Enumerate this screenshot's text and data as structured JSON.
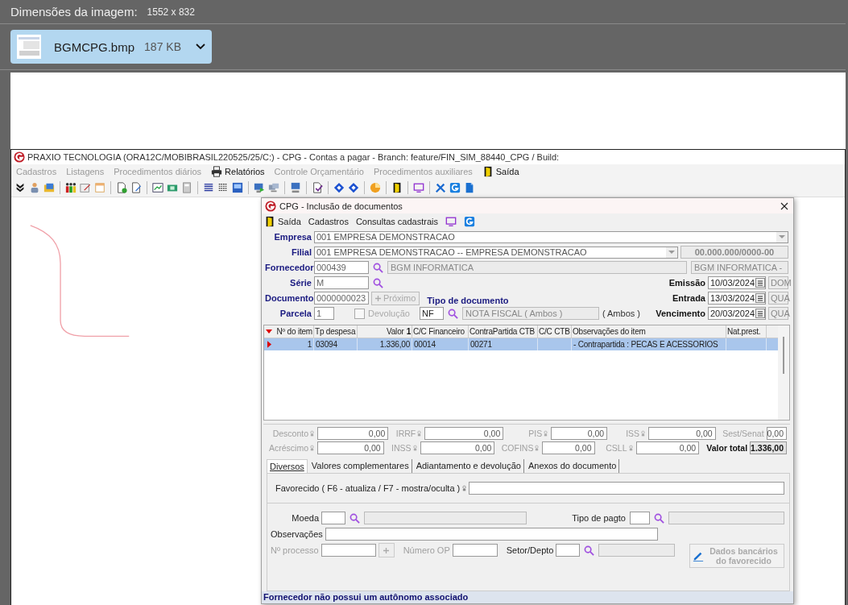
{
  "viewer": {
    "label": "Dimensões da imagem:",
    "dimensions": "1552 x 832",
    "file_name": "BGMCPG.bmp",
    "file_size": "187 KB"
  },
  "app": {
    "title": "PRAXIO TECNOLOGIA (ORA12C/MOBIBRASIL220525/25/C:) - CPG - Contas a pagar - Branch: feature/FIN_SIM_88440_CPG / Build:",
    "menu": [
      {
        "label": "Cadastros",
        "disabled": true
      },
      {
        "label": "Listagens",
        "disabled": true
      },
      {
        "label": "Procedimentos diários",
        "disabled": true
      },
      {
        "label": "Relatórios",
        "disabled": false
      },
      {
        "label": "Controle Orçamentário",
        "disabled": true
      },
      {
        "label": "Procedimentos auxiliares",
        "disabled": true
      },
      {
        "label": "Saída",
        "disabled": false
      }
    ]
  },
  "dialog": {
    "title": "CPG - Inclusão de documentos",
    "menu": [
      {
        "label": "Saída"
      },
      {
        "label": "Cadastros"
      },
      {
        "label": "Consultas cadastrais"
      }
    ],
    "form": {
      "empresa": {
        "label": "Empresa",
        "value": "001 EMPRESA DEMONSTRACAO"
      },
      "filial": {
        "label": "Filial",
        "value": "001 EMPRESA DEMONSTRACAO -- EMPRESA DEMONSTRACAO",
        "cnpj": "00.000.000/0000-00"
      },
      "fornecedor": {
        "label": "Fornecedor",
        "code": "000439",
        "name": "BGM INFORMATICA",
        "alt_name": "BGM INFORMATICA -"
      },
      "serie": {
        "label": "Série",
        "value": "M"
      },
      "documento": {
        "label": "Documento",
        "value": "0000000023"
      },
      "proximo": {
        "label": "Próximo",
        "disabled": true
      },
      "parcela": {
        "label": "Parcela",
        "value": "1"
      },
      "devolucao": {
        "label": "Devolução",
        "checked": false,
        "disabled": true
      },
      "tipo_documento": {
        "label": "Tipo de documento",
        "code": "NF",
        "name": "NOTA FISCAL ( Ambos )",
        "note": "( Ambos )"
      },
      "dates": [
        {
          "label": "Emissão",
          "value": "10/03/2024",
          "weekday": "DOM"
        },
        {
          "label": "Entrada",
          "value": "13/03/2024",
          "weekday": "QUA"
        },
        {
          "label": "Vencimento",
          "value": "20/03/2024",
          "weekday": "QUA"
        }
      ]
    },
    "table": {
      "columns": [
        {
          "label": "Nº do item"
        },
        {
          "label": "Tp despesa"
        },
        {
          "label": "Valor",
          "sort": "1"
        },
        {
          "label": "C/C Financeiro"
        },
        {
          "label": "ContraPartida CTB"
        },
        {
          "label": "C/C CTB"
        },
        {
          "label": "Observações do item"
        },
        {
          "label": "Nat.prest."
        }
      ],
      "rows": [
        {
          "selected": true,
          "cells": [
            "1",
            "03094",
            "1.336,00",
            "00014",
            "00271",
            null,
            "- Contrapartida : PECAS E ACESSORIOS",
            null
          ]
        }
      ]
    },
    "totals": [
      {
        "kind": "field",
        "label": "Desconto",
        "value": "0,00",
        "disabled": true,
        "icon": true
      },
      {
        "kind": "field",
        "label": "IRRF",
        "value": "0,00",
        "disabled": true,
        "icon": true
      },
      {
        "kind": "field",
        "label": "PIS",
        "value": "0,00",
        "disabled": true,
        "icon": true
      },
      {
        "kind": "field",
        "label": "ISS",
        "value": "0,00",
        "disabled": true,
        "icon": true
      },
      {
        "kind": "field",
        "label": "Sest/Senat",
        "value": "0,00",
        "disabled": true,
        "icon": false
      },
      {
        "kind": "field",
        "label": "Acréscimo",
        "value": "0,00",
        "disabled": true,
        "icon": true
      },
      {
        "kind": "field",
        "label": "INSS",
        "value": "0,00",
        "disabled": true,
        "icon": true
      },
      {
        "kind": "field",
        "label": "COFINS",
        "value": "0,00",
        "disabled": true,
        "icon": true
      },
      {
        "kind": "field",
        "label": "CSLL",
        "value": "0,00",
        "disabled": true,
        "icon": true
      },
      {
        "kind": "total",
        "label": "Valor total",
        "value": "1.336,00"
      }
    ],
    "tabs": [
      {
        "label": "Diversos",
        "selected": true
      },
      {
        "label": "Valores complementares",
        "selected": false
      },
      {
        "label": "Adiantamento e devolução",
        "selected": false
      },
      {
        "label": "Anexos do documento",
        "selected": false
      }
    ],
    "diversos": {
      "favorecido": "Favorecido ( F6 - atualiza / F7 - mostra/oculta )",
      "moeda": "Moeda",
      "tipo_pagto": "Tipo de pagto",
      "observacoes": "Observações",
      "processo": {
        "label": "Nº processo",
        "disabled": true
      },
      "numero_op": {
        "label": "Número OP",
        "disabled": true
      },
      "setor": "Setor/Depto",
      "bank_button": {
        "label": "Dados bancários do favorecido",
        "disabled": true
      }
    },
    "status": "Fornecedor não possui um autônomo associado"
  }
}
